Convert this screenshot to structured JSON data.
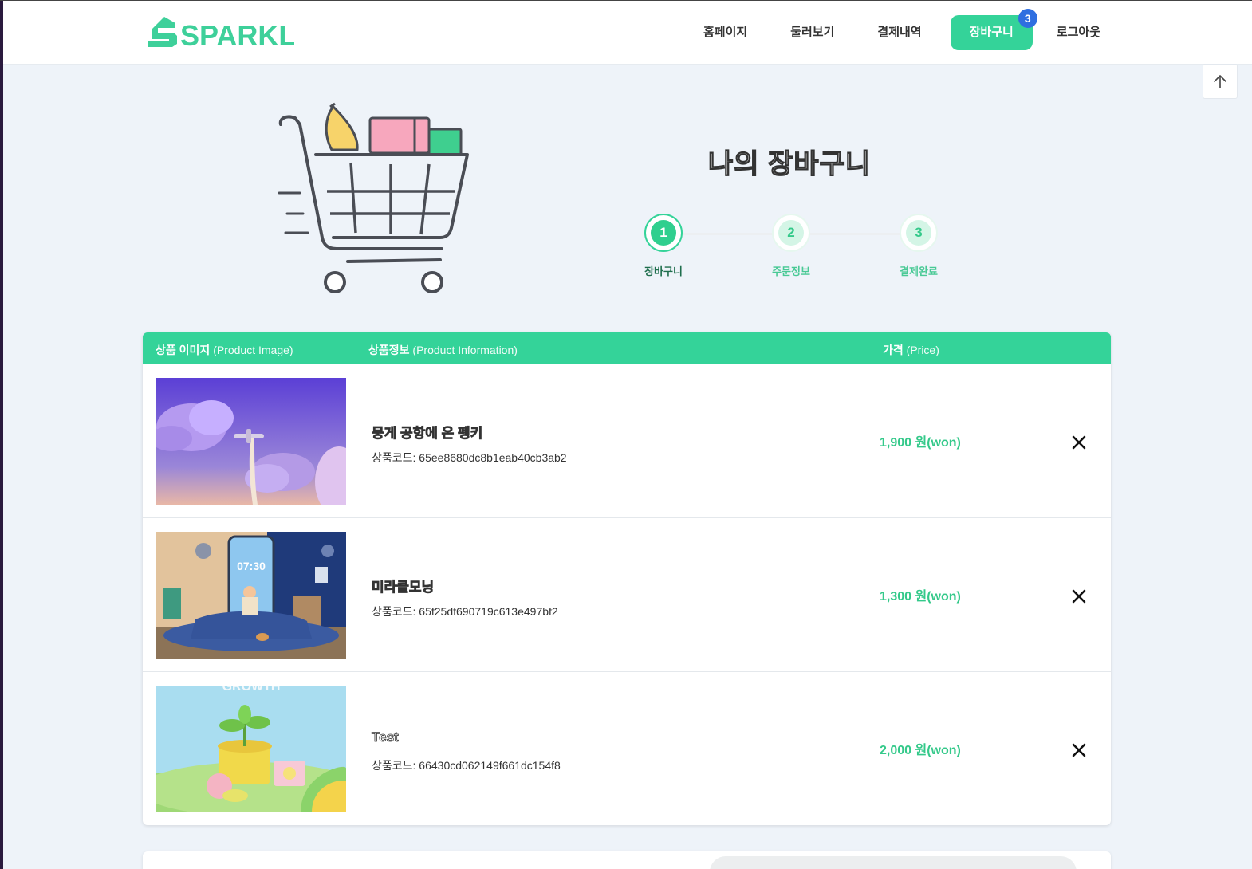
{
  "brand": {
    "logo_text": "SPARKLE",
    "color": "#34d399"
  },
  "nav": {
    "items": [
      {
        "label": "홈페이지"
      },
      {
        "label": "둘러보기"
      },
      {
        "label": "결제내역"
      },
      {
        "label": "장바구니",
        "badge": "3",
        "active": true
      },
      {
        "label": "로그아웃"
      }
    ]
  },
  "scroll_top_icon": "arrow-up-icon",
  "hero": {
    "title": "나의 장바구니",
    "steps": [
      {
        "number": "1",
        "label": "장바구니",
        "active": true
      },
      {
        "number": "2",
        "label": "주문정보"
      },
      {
        "number": "3",
        "label": "결제완료"
      }
    ]
  },
  "table": {
    "headers": {
      "image": {
        "ko": "상품 이미지",
        "en": "(Product Image)"
      },
      "info": {
        "ko": "상품정보",
        "en": "(Product Information)"
      },
      "price": {
        "ko": "가격",
        "en": "(Price)"
      }
    },
    "rows": [
      {
        "name": "뭉게 공항에 온 펭키",
        "code": "상품코드: 65ee8680dc8b1eab40cb3ab2",
        "price": "1,900 원(won)",
        "remove_icon": "close-icon"
      },
      {
        "name": "미라클모닝",
        "code": "상품코드: 65f25df690719c613e497bf2",
        "price": "1,300 원(won)",
        "remove_icon": "close-icon"
      },
      {
        "name": "Test",
        "code": "상품코드: 66430cd062149f661dc154f8",
        "price": "2,000 원(won)",
        "remove_icon": "close-icon"
      }
    ]
  }
}
